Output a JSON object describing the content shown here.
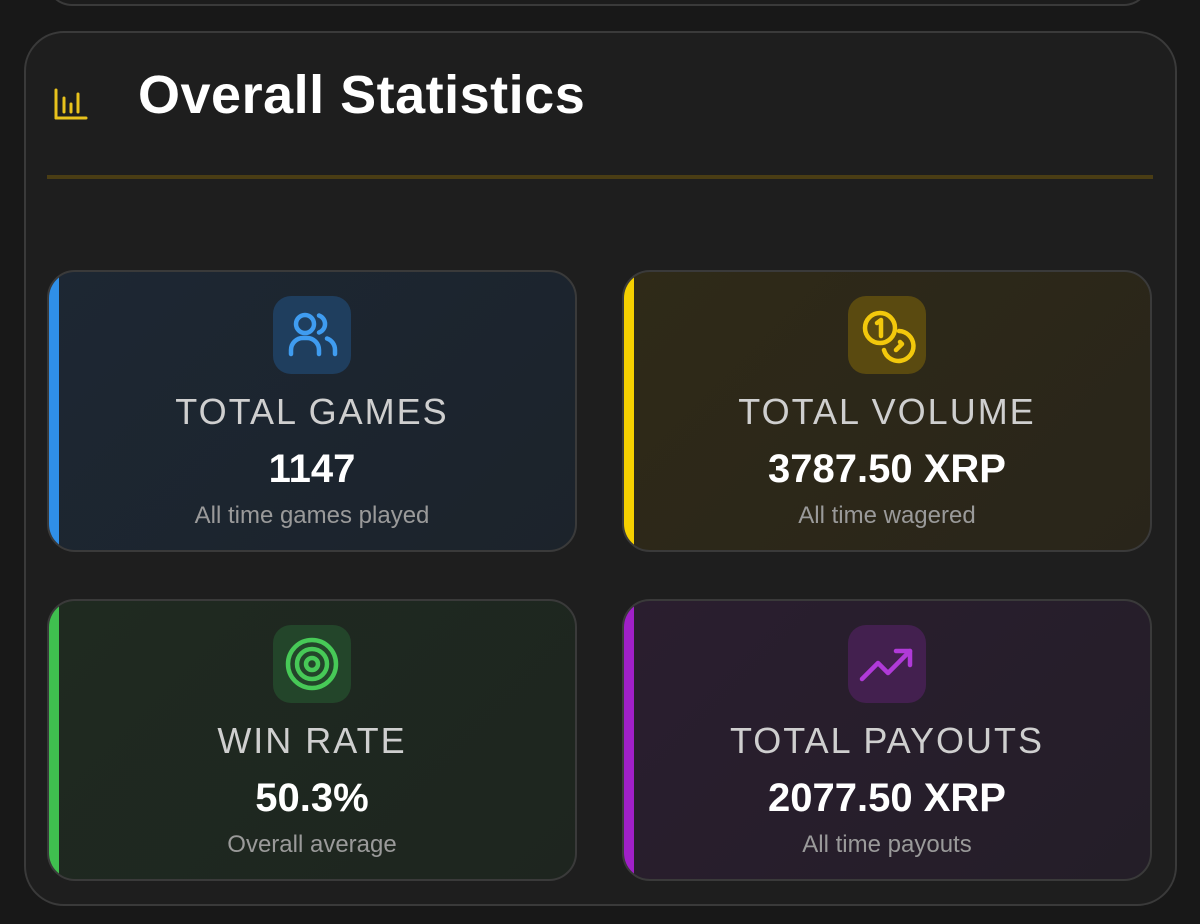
{
  "section": {
    "title": "Overall Statistics",
    "icon": "bar-chart-icon",
    "accent_color": "#e8c21c"
  },
  "stats": [
    {
      "id": "games",
      "label": "TOTAL GAMES",
      "value": "1147",
      "subtitle": "All time games played",
      "icon": "users-icon",
      "accent_color": "#2f8fe8"
    },
    {
      "id": "volume",
      "label": "TOTAL VOLUME",
      "value": "3787.50 XRP",
      "subtitle": "All time wagered",
      "icon": "coins-icon",
      "accent_color": "#f5d000"
    },
    {
      "id": "winrate",
      "label": "WIN RATE",
      "value": "50.3%",
      "subtitle": "Overall average",
      "icon": "target-icon",
      "accent_color": "#3fbf4f"
    },
    {
      "id": "payouts",
      "label": "TOTAL PAYOUTS",
      "value": "2077.50 XRP",
      "subtitle": "All time payouts",
      "icon": "trending-up-icon",
      "accent_color": "#a020c8"
    }
  ]
}
